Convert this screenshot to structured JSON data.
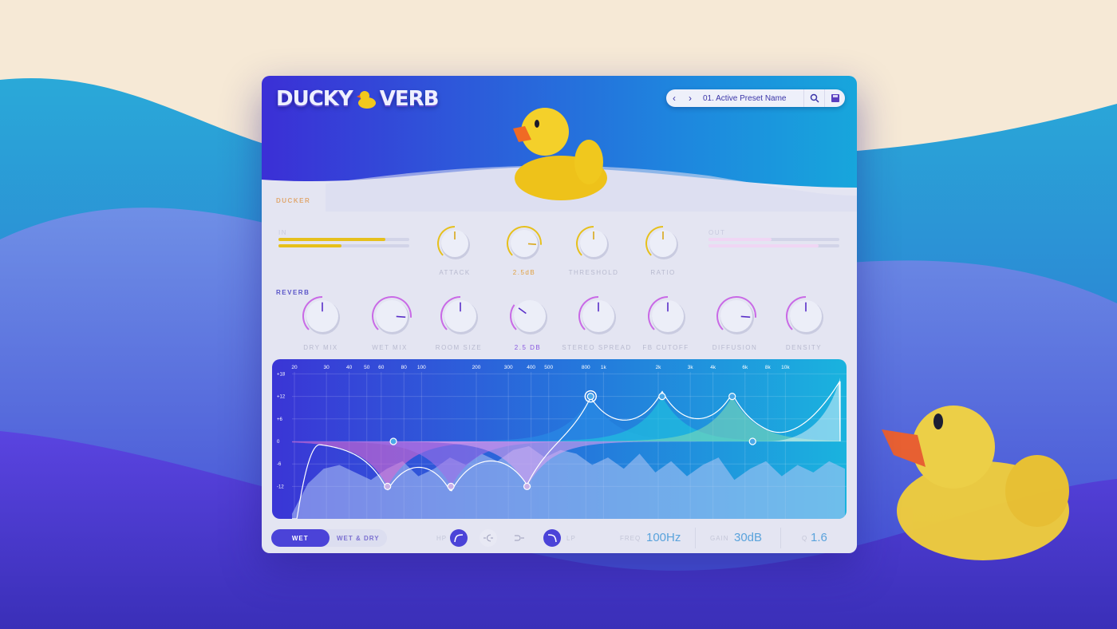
{
  "app": {
    "logo_text_left": "DUCKY",
    "logo_text_right": "VERB"
  },
  "preset": {
    "prev_icon": "chevron-left",
    "next_icon": "chevron-right",
    "name": "01. Active Preset Name",
    "search_icon": "search",
    "save_icon": "floppy-disk"
  },
  "ducker": {
    "title": "DUCKER",
    "in_label": "IN",
    "out_label": "OUT",
    "in_levels": [
      0.82,
      0.48
    ],
    "out_levels": [
      0.48,
      0.84
    ],
    "knobs": [
      {
        "label": "ATTACK",
        "value": 0.5
      },
      {
        "label": "2.5dB",
        "value": 0.85,
        "active": true
      },
      {
        "label": "THRESHOLD",
        "value": 0.5
      },
      {
        "label": "RATIO",
        "value": 0.5
      }
    ],
    "color": "#e6c01c"
  },
  "reverb": {
    "title": "REVERB",
    "color": "#c96ae6",
    "knobs": [
      {
        "label": "DRY MIX",
        "value": 0.5
      },
      {
        "label": "WET MIX",
        "value": 0.85
      },
      {
        "label": "ROOM SIZE",
        "value": 0.5
      },
      {
        "label": "2.5 DB",
        "value": 0.3,
        "active": true
      },
      {
        "label": "STEREO SPREAD",
        "value": 0.5
      },
      {
        "label": "FB CUTOFF",
        "value": 0.5
      },
      {
        "label": "DIFFUSION",
        "value": 0.85
      },
      {
        "label": "DENSITY",
        "value": 0.5
      }
    ]
  },
  "eq": {
    "freq_ticks": [
      "20",
      "30",
      "40",
      "50",
      "60",
      "80",
      "100",
      "200",
      "300",
      "400",
      "500",
      "800",
      "1k",
      "2k",
      "3k",
      "4k",
      "6k",
      "8k",
      "10k"
    ],
    "freq_values": [
      20,
      30,
      40,
      50,
      60,
      80,
      100,
      200,
      300,
      400,
      500,
      800,
      1000,
      2000,
      3000,
      4000,
      6000,
      8000,
      10000
    ],
    "gain_ticks": [
      "+18",
      "+12",
      "+6",
      "0",
      "-6",
      "-12"
    ],
    "gain_values": [
      18,
      12,
      6,
      0,
      -6,
      -12
    ],
    "bands": [
      {
        "type": "highpass",
        "freq": 20,
        "gain": 0
      },
      {
        "type": "bell",
        "freq": 65,
        "gain": -12,
        "color": "#d86ad0"
      },
      {
        "type": "bell",
        "freq": 145,
        "gain": -12,
        "color": "#a070e8"
      },
      {
        "type": "bell",
        "freq": 380,
        "gain": -12,
        "color": "#d8a0ee"
      },
      {
        "type": "bell",
        "freq": 850,
        "gain": 12,
        "color": "#2a8de6",
        "selected": true
      },
      {
        "type": "bell",
        "freq": 2100,
        "gain": 12,
        "color": "#20c8e0"
      },
      {
        "type": "bell",
        "freq": 5100,
        "gain": 12,
        "color": "#7cd8b8"
      },
      {
        "type": "highshelf",
        "freq": 6600,
        "gain": 0
      }
    ],
    "spectrum_db": [
      -18,
      -10,
      -6,
      -5,
      -7,
      -9,
      -6,
      -4,
      -8,
      -6,
      -3,
      -5,
      -2,
      -4,
      -1,
      0,
      -3,
      -1,
      -2,
      -5,
      -3,
      -6,
      -2,
      -7,
      -4,
      -8,
      -5,
      -3,
      -9,
      -6,
      -4,
      -8,
      -5,
      -7,
      -4,
      -6
    ]
  },
  "footer": {
    "wet_label": "WET",
    "wetdry_label": "WET & DRY",
    "hp_label": "HP",
    "lp_label": "LP",
    "freq_label": "FREQ",
    "freq_value": "100Hz",
    "gain_label": "GAIN",
    "gain_value": "30dB",
    "q_label": "Q",
    "q_value": "1.6"
  }
}
